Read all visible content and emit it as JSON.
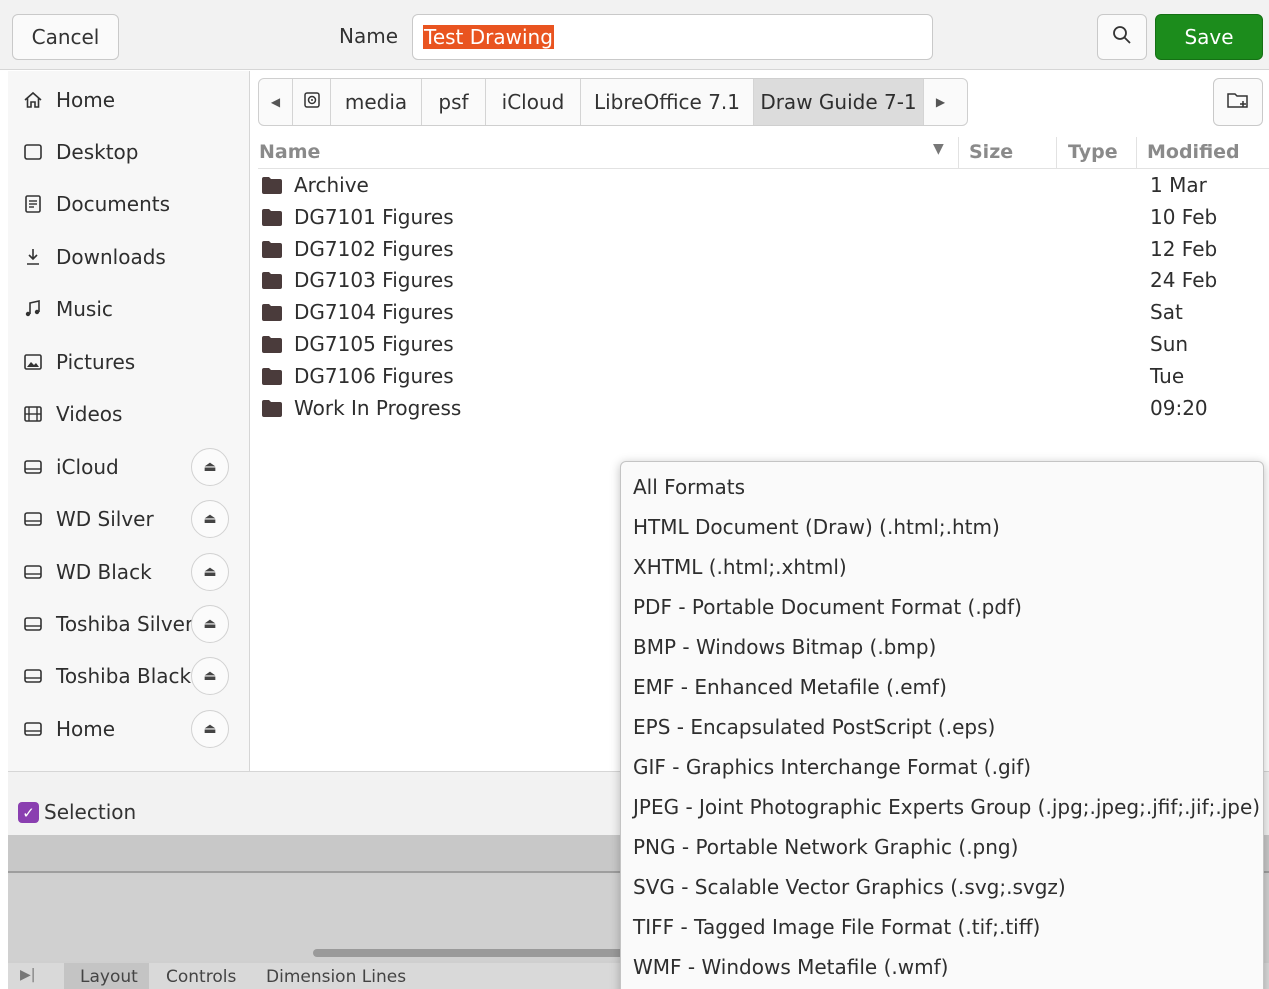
{
  "header": {
    "cancel_label": "Cancel",
    "name_label": "Name",
    "filename_value": "Test Drawing",
    "save_label": "Save"
  },
  "sidebar": {
    "items": [
      {
        "label": "Home",
        "icon": "home-icon"
      },
      {
        "label": "Desktop",
        "icon": "desktop-icon"
      },
      {
        "label": "Documents",
        "icon": "documents-icon"
      },
      {
        "label": "Downloads",
        "icon": "downloads-icon"
      },
      {
        "label": "Music",
        "icon": "music-icon"
      },
      {
        "label": "Pictures",
        "icon": "pictures-icon"
      },
      {
        "label": "Videos",
        "icon": "videos-icon"
      },
      {
        "label": "iCloud",
        "icon": "drive-icon"
      },
      {
        "label": "WD Silver",
        "icon": "drive-icon"
      },
      {
        "label": "WD Black",
        "icon": "drive-icon"
      },
      {
        "label": "Toshiba Silver",
        "icon": "drive-icon"
      },
      {
        "label": "Toshiba Black",
        "icon": "drive-icon"
      },
      {
        "label": "Home",
        "icon": "drive-icon"
      }
    ]
  },
  "pathbar": {
    "crumbs": [
      "media",
      "psf",
      "iCloud",
      "LibreOffice 7.1",
      "Draw Guide 7-1"
    ]
  },
  "columns": {
    "name": "Name",
    "size": "Size",
    "type": "Type",
    "modified": "Modified"
  },
  "files": [
    {
      "name": "Archive",
      "modified": "1 Mar"
    },
    {
      "name": "DG7101 Figures",
      "modified": "10 Feb"
    },
    {
      "name": "DG7102 Figures",
      "modified": "12 Feb"
    },
    {
      "name": "DG7103 Figures",
      "modified": "24 Feb"
    },
    {
      "name": "DG7104 Figures",
      "modified": "Sat"
    },
    {
      "name": "DG7105 Figures",
      "modified": "Sun"
    },
    {
      "name": "DG7106 Figures",
      "modified": "Tue"
    },
    {
      "name": "Work In Progress",
      "modified": "09:20"
    }
  ],
  "footer": {
    "selection_label": "Selection"
  },
  "background_app": {
    "tabs": [
      "Layout",
      "Controls",
      "Dimension Lines"
    ]
  },
  "format_menu": {
    "items": [
      "All Formats",
      "HTML Document (Draw) (.html;.htm)",
      "XHTML (.html;.xhtml)",
      "PDF - Portable Document Format (.pdf)",
      "BMP - Windows Bitmap (.bmp)",
      "EMF - Enhanced Metafile (.emf)",
      "EPS - Encapsulated PostScript (.eps)",
      "GIF - Graphics Interchange Format (.gif)",
      "JPEG - Joint Photographic Experts Group (.jpg;.jpeg;.jfif;.jif;.jpe)",
      "PNG - Portable Network Graphic (.png)",
      "SVG - Scalable Vector Graphics (.svg;.svgz)",
      "TIFF - Tagged Image File Format (.tif;.tiff)",
      "WMF - Windows Metafile (.wmf)"
    ]
  },
  "colors": {
    "accent": "#e95420",
    "save_green": "#1c8c1c",
    "checkbox_purple": "#8a3fb0",
    "folder": "#4a3b3b"
  }
}
